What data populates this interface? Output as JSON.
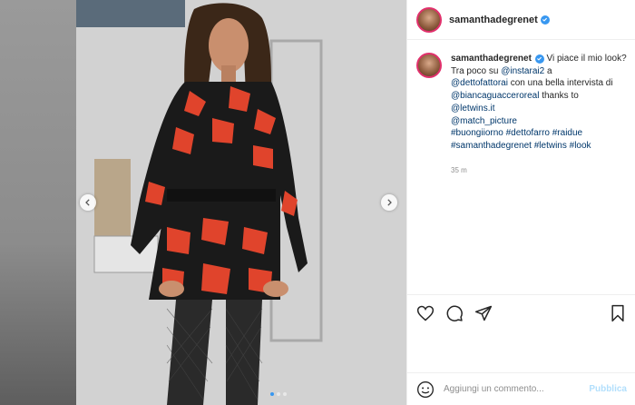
{
  "post": {
    "username": "samanthadegrenet",
    "verified_icon": "verified-badge-icon",
    "time_ago": "35 m",
    "carousel_dots": 3,
    "active_dot": 1
  },
  "caption": {
    "line_intro": "Vi piace il mio look? Tra poco su ",
    "mention_instarai2": "@instarai2",
    "text_a": " a ",
    "mention_dettofattorai": "@dettofattorai",
    "text_b": " con una bella intervista di ",
    "mention_biancaguaccero": "@biancaguacceroreal",
    "text_c": " thanks to ",
    "mention_letwins": "@letwins.it",
    "mention_match": "@match_picture",
    "hashtags_line1": "#buongiiorno #dettofarro #raidue",
    "hashtags_line2": "#samanthadegrenet #letwins #look"
  },
  "comment": {
    "placeholder": "Aggiungi un commento...",
    "publish_label": "Pubblica"
  },
  "colors": {
    "link": "#00376b",
    "verified": "#3897f0",
    "publish_disabled": "#b2dffc",
    "dress_red": "#e0442c",
    "dress_black": "#1a1a1a"
  }
}
